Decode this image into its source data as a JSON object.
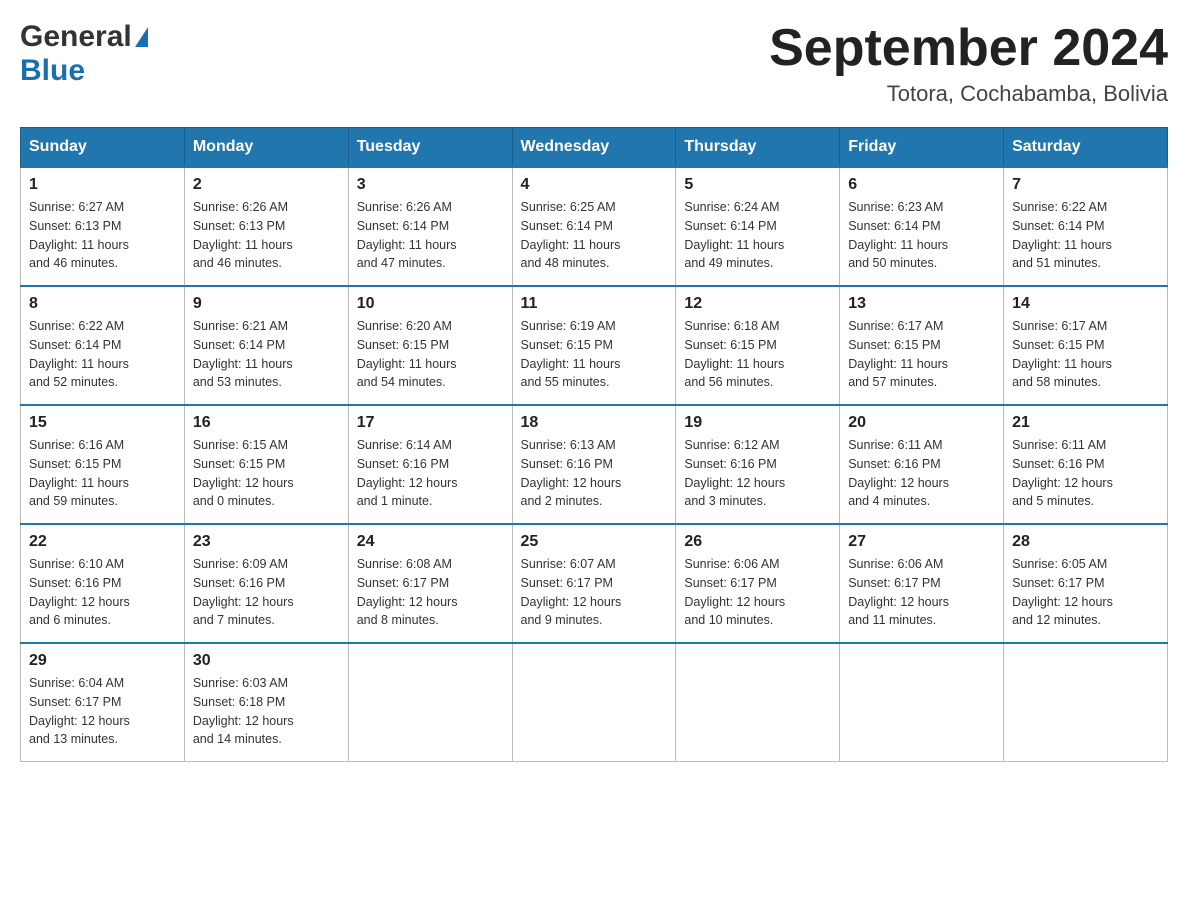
{
  "logo": {
    "general": "General",
    "blue": "Blue"
  },
  "header": {
    "month_year": "September 2024",
    "location": "Totora, Cochabamba, Bolivia"
  },
  "days_of_week": [
    "Sunday",
    "Monday",
    "Tuesday",
    "Wednesday",
    "Thursday",
    "Friday",
    "Saturday"
  ],
  "weeks": [
    [
      {
        "day": "1",
        "sunrise": "6:27 AM",
        "sunset": "6:13 PM",
        "daylight": "11 hours and 46 minutes."
      },
      {
        "day": "2",
        "sunrise": "6:26 AM",
        "sunset": "6:13 PM",
        "daylight": "11 hours and 46 minutes."
      },
      {
        "day": "3",
        "sunrise": "6:26 AM",
        "sunset": "6:14 PM",
        "daylight": "11 hours and 47 minutes."
      },
      {
        "day": "4",
        "sunrise": "6:25 AM",
        "sunset": "6:14 PM",
        "daylight": "11 hours and 48 minutes."
      },
      {
        "day": "5",
        "sunrise": "6:24 AM",
        "sunset": "6:14 PM",
        "daylight": "11 hours and 49 minutes."
      },
      {
        "day": "6",
        "sunrise": "6:23 AM",
        "sunset": "6:14 PM",
        "daylight": "11 hours and 50 minutes."
      },
      {
        "day": "7",
        "sunrise": "6:22 AM",
        "sunset": "6:14 PM",
        "daylight": "11 hours and 51 minutes."
      }
    ],
    [
      {
        "day": "8",
        "sunrise": "6:22 AM",
        "sunset": "6:14 PM",
        "daylight": "11 hours and 52 minutes."
      },
      {
        "day": "9",
        "sunrise": "6:21 AM",
        "sunset": "6:14 PM",
        "daylight": "11 hours and 53 minutes."
      },
      {
        "day": "10",
        "sunrise": "6:20 AM",
        "sunset": "6:15 PM",
        "daylight": "11 hours and 54 minutes."
      },
      {
        "day": "11",
        "sunrise": "6:19 AM",
        "sunset": "6:15 PM",
        "daylight": "11 hours and 55 minutes."
      },
      {
        "day": "12",
        "sunrise": "6:18 AM",
        "sunset": "6:15 PM",
        "daylight": "11 hours and 56 minutes."
      },
      {
        "day": "13",
        "sunrise": "6:17 AM",
        "sunset": "6:15 PM",
        "daylight": "11 hours and 57 minutes."
      },
      {
        "day": "14",
        "sunrise": "6:17 AM",
        "sunset": "6:15 PM",
        "daylight": "11 hours and 58 minutes."
      }
    ],
    [
      {
        "day": "15",
        "sunrise": "6:16 AM",
        "sunset": "6:15 PM",
        "daylight": "11 hours and 59 minutes."
      },
      {
        "day": "16",
        "sunrise": "6:15 AM",
        "sunset": "6:15 PM",
        "daylight": "12 hours and 0 minutes."
      },
      {
        "day": "17",
        "sunrise": "6:14 AM",
        "sunset": "6:16 PM",
        "daylight": "12 hours and 1 minute."
      },
      {
        "day": "18",
        "sunrise": "6:13 AM",
        "sunset": "6:16 PM",
        "daylight": "12 hours and 2 minutes."
      },
      {
        "day": "19",
        "sunrise": "6:12 AM",
        "sunset": "6:16 PM",
        "daylight": "12 hours and 3 minutes."
      },
      {
        "day": "20",
        "sunrise": "6:11 AM",
        "sunset": "6:16 PM",
        "daylight": "12 hours and 4 minutes."
      },
      {
        "day": "21",
        "sunrise": "6:11 AM",
        "sunset": "6:16 PM",
        "daylight": "12 hours and 5 minutes."
      }
    ],
    [
      {
        "day": "22",
        "sunrise": "6:10 AM",
        "sunset": "6:16 PM",
        "daylight": "12 hours and 6 minutes."
      },
      {
        "day": "23",
        "sunrise": "6:09 AM",
        "sunset": "6:16 PM",
        "daylight": "12 hours and 7 minutes."
      },
      {
        "day": "24",
        "sunrise": "6:08 AM",
        "sunset": "6:17 PM",
        "daylight": "12 hours and 8 minutes."
      },
      {
        "day": "25",
        "sunrise": "6:07 AM",
        "sunset": "6:17 PM",
        "daylight": "12 hours and 9 minutes."
      },
      {
        "day": "26",
        "sunrise": "6:06 AM",
        "sunset": "6:17 PM",
        "daylight": "12 hours and 10 minutes."
      },
      {
        "day": "27",
        "sunrise": "6:06 AM",
        "sunset": "6:17 PM",
        "daylight": "12 hours and 11 minutes."
      },
      {
        "day": "28",
        "sunrise": "6:05 AM",
        "sunset": "6:17 PM",
        "daylight": "12 hours and 12 minutes."
      }
    ],
    [
      {
        "day": "29",
        "sunrise": "6:04 AM",
        "sunset": "6:17 PM",
        "daylight": "12 hours and 13 minutes."
      },
      {
        "day": "30",
        "sunrise": "6:03 AM",
        "sunset": "6:18 PM",
        "daylight": "12 hours and 14 minutes."
      },
      null,
      null,
      null,
      null,
      null
    ]
  ],
  "labels": {
    "sunrise": "Sunrise:",
    "sunset": "Sunset:",
    "daylight": "Daylight:"
  }
}
